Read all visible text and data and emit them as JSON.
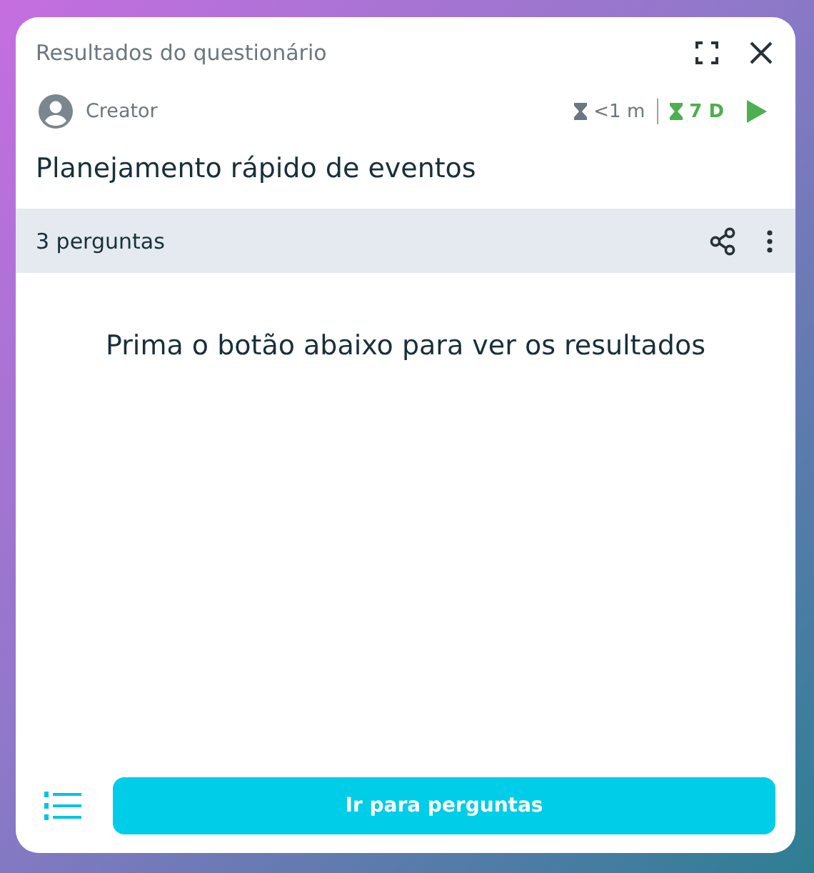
{
  "window": {
    "title": "Resultados do questionário"
  },
  "meta": {
    "author": "Creator",
    "duration": "<1 m",
    "remaining": "7 D"
  },
  "quiz_title": "Planejamento rápido de eventos",
  "toolbar": {
    "count": "3 perguntas"
  },
  "message": "Prima o botão abaixo para ver os resultados",
  "footer": {
    "button": "Ir para perguntas"
  }
}
